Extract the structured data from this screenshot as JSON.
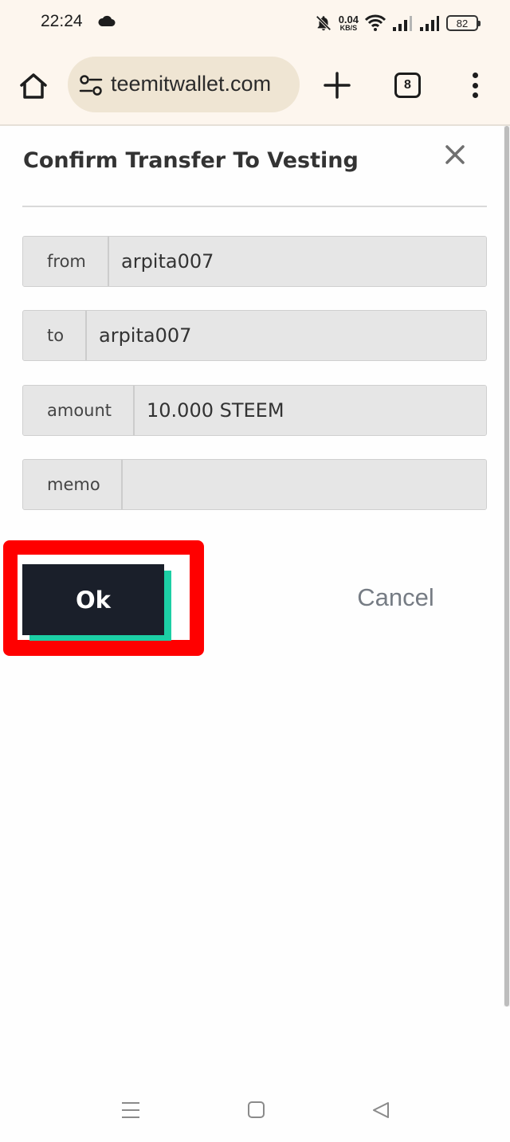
{
  "status_bar": {
    "time": "22:24",
    "net_speed_value": "0.04",
    "net_speed_unit": "KB/S",
    "battery_level": "82",
    "icons": [
      "cloud-icon",
      "bell-off-icon",
      "wifi-icon",
      "signal-icon",
      "battery-icon"
    ]
  },
  "browser": {
    "url": "teemitwallet.com",
    "tab_count": "8",
    "icons": [
      "home-icon",
      "site-settings-icon",
      "plus-icon",
      "tabs-icon",
      "more-vert-icon"
    ]
  },
  "dialog": {
    "title": "Confirm Transfer To Vesting",
    "fields": [
      {
        "label": "from",
        "value": "arpita007"
      },
      {
        "label": "to",
        "value": "arpita007"
      },
      {
        "label": "amount",
        "value": "10.000 STEEM"
      },
      {
        "label": "memo",
        "value": ""
      }
    ],
    "ok_label": "Ok",
    "cancel_label": "Cancel",
    "colors": {
      "ok_bg": "#1a1f2a",
      "ok_accent": "#1ccfa5",
      "highlight": "#ff0000",
      "cancel_text": "#767c84"
    }
  },
  "nav_bar": {
    "icons": [
      "recents-icon",
      "home-square-icon",
      "back-triangle-icon"
    ]
  }
}
